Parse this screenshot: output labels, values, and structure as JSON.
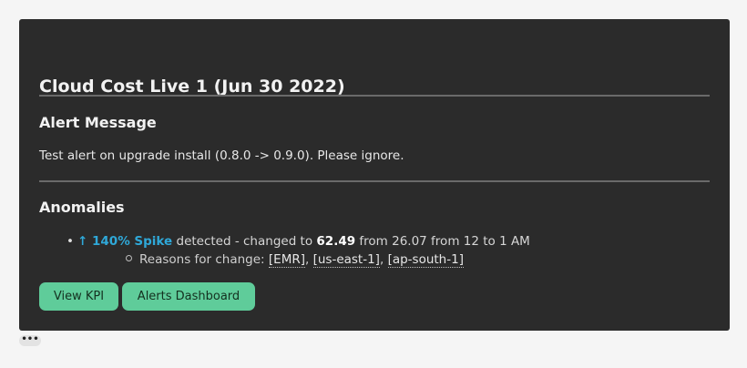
{
  "card": {
    "title": "Cloud Cost Live 1 (Jun 30 2022)",
    "alert_heading": "Alert Message",
    "alert_message": "Test alert on upgrade install (0.8.0 -> 0.9.0). Please ignore.",
    "anomalies_heading": "Anomalies"
  },
  "anomaly": {
    "spike_label": "↑ 140% Spike",
    "detected_text": " detected - changed to ",
    "new_value": "62.49",
    "from_text": " from 26.07 from 12 to 1 AM",
    "reasons_prefix": "Reasons for change: ",
    "reasons": [
      "[EMR]",
      "[us-east-1]",
      "[ap-south-1]"
    ],
    "separator": ", "
  },
  "buttons": {
    "view_kpi": "View KPI",
    "alerts_dashboard": "Alerts Dashboard"
  },
  "more_label": "•••",
  "colors": {
    "card_bg": "#2b2b2b",
    "spike_accent": "#2fa8d8",
    "button_bg": "#5fcc9a"
  },
  "icons": {
    "bullet": "disc",
    "sub_bullet": "circle-icon",
    "more": "ellipsis-icon"
  }
}
